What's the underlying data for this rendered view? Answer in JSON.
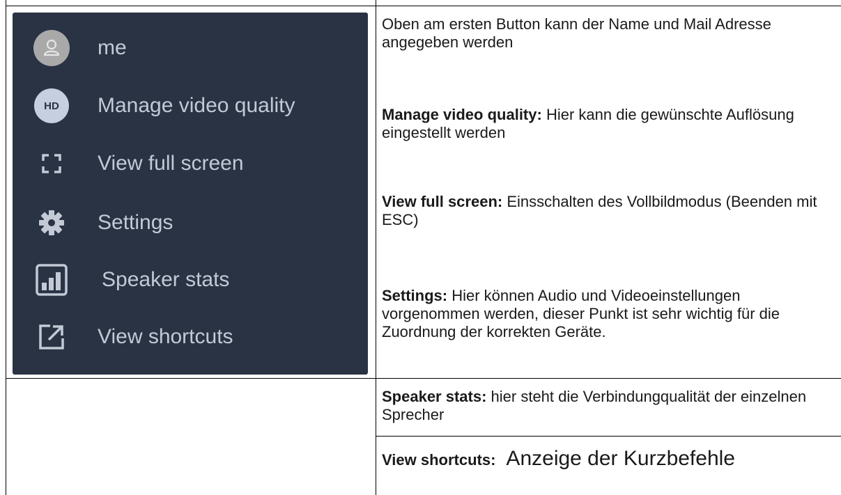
{
  "menu": {
    "items": [
      {
        "label": "me",
        "icon": "user-avatar-icon"
      },
      {
        "label": "Manage video quality",
        "icon": "hd-icon",
        "badge": "HD"
      },
      {
        "label": "View full screen",
        "icon": "fullscreen-icon"
      },
      {
        "label": "Settings",
        "icon": "gear-icon"
      },
      {
        "label": "Speaker stats",
        "icon": "bar-chart-icon"
      },
      {
        "label": "View shortcuts",
        "icon": "external-link-icon"
      }
    ],
    "background": "#2a3344"
  },
  "descriptions": {
    "intro": "Oben am ersten Button kann der Name und Mail Adresse angegeben werden",
    "video_quality": {
      "term": "Manage video quality:",
      "text": " Hier kann die gewünschte Auflösung eingestellt werden"
    },
    "full_screen": {
      "term": "View full screen:",
      "text": "  Einsschalten des Vollbildmodus (Beenden mit ESC)"
    },
    "settings": {
      "term": "Settings:",
      "text": " Hier können Audio und Videoeinstellungen vorgenommen werden, dieser Punkt ist sehr wichtig für die Zuordnung der korrekten Geräte."
    },
    "speaker_stats": {
      "term": "Speaker stats:",
      "text": " hier steht die Verbindungqualität der einzelnen Sprecher"
    },
    "shortcuts": {
      "term": "View shortcuts:",
      "text": "  Anzeige der Kurzbefehle"
    }
  }
}
